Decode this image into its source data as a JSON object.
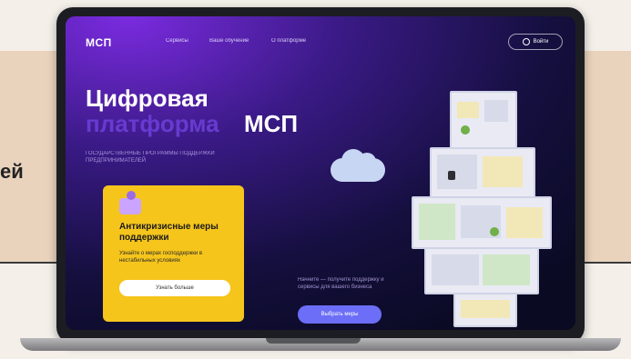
{
  "context": {
    "side_text": "ей"
  },
  "site": {
    "logo": "МСП",
    "nav": [
      "Сервисы",
      "Ваше обучение",
      "О платформе"
    ],
    "login_label": "Войти"
  },
  "hero": {
    "title_line1": "Цифровая",
    "title_line2_part1": "платформа",
    "title_line2_part2": "МСП",
    "subtitle": "ГОСУДАРСТВЕННЫЕ ПРОГРАММЫ ПОДДЕРЖКИ ПРЕДПРИНИМАТЕЛЕЙ"
  },
  "card": {
    "title": "Антикризисные меры поддержки",
    "text": "Узнайте о мерах господдержки в нестабильных условиях",
    "button_label": "Узнать больше"
  },
  "cta": {
    "note": "Начните — получите поддержку и сервисы для вашего бизнеса",
    "button_label": "Выбрать меры"
  },
  "colors": {
    "screen_bg": "#3a1a86",
    "accent_yellow": "#f5c51c",
    "button_blue": "#6c6ef7"
  }
}
